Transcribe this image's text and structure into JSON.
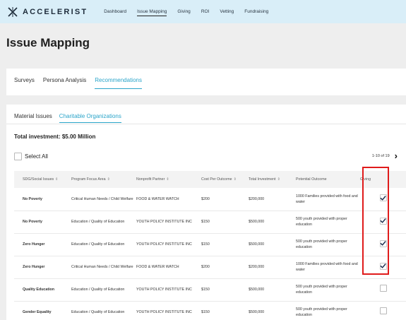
{
  "app": {
    "name": "ACCELERIST",
    "nav": [
      {
        "label": "Dashboard",
        "active": false
      },
      {
        "label": "Issue Mapping",
        "active": true
      },
      {
        "label": "Giving",
        "active": false
      },
      {
        "label": "ROI",
        "active": false
      },
      {
        "label": "Vetting",
        "active": false
      },
      {
        "label": "Fundraising",
        "active": false
      }
    ],
    "brand_color": "#2aa4c9",
    "highlight_color": "#e01b1b"
  },
  "page": {
    "title": "Issue Mapping"
  },
  "tabs": [
    {
      "label": "Surveys",
      "active": false
    },
    {
      "label": "Persona Analysis",
      "active": false
    },
    {
      "label": "Recommendations",
      "active": true
    }
  ],
  "subtabs": [
    {
      "label": "Material Issues",
      "active": false
    },
    {
      "label": "Charitable Organizations",
      "active": true
    }
  ],
  "total_investment": "Total investment: $5.00 Million",
  "select_all_label": "Select All",
  "pagination": {
    "text": "1-10 of 19",
    "next_icon": "chevron-right-icon"
  },
  "table": {
    "columns": [
      {
        "label": "SDG/Social Issues",
        "sortable": true
      },
      {
        "label": "Program Focus Area",
        "sortable": true
      },
      {
        "label": "Nonprofit Partner",
        "sortable": true
      },
      {
        "label": "Cost Per Outcome",
        "sortable": true
      },
      {
        "label": "Total Investment",
        "sortable": true
      },
      {
        "label": "Potential Outcome",
        "sortable": false
      },
      {
        "label": "Giving",
        "sortable": false
      }
    ],
    "rows": [
      {
        "sdg": "No Poverty",
        "focus": "Critical Human Needs / Child Welfare",
        "partner": "FOOD & WATER WATCH",
        "cost": "$200",
        "total": "$200,000",
        "outcome": "1000 Families provided with food and water",
        "giving": true
      },
      {
        "sdg": "No Poverty",
        "focus": "Education / Quality of Education",
        "partner": "YOUTH POLICY INSTITUTE INC",
        "cost": "$150",
        "total": "$500,000",
        "outcome": "500 youth provided with proper education",
        "giving": true
      },
      {
        "sdg": "Zero Hunger",
        "focus": "Education / Quality of Education",
        "partner": "YOUTH POLICY INSTITUTE INC",
        "cost": "$150",
        "total": "$500,000",
        "outcome": "500 youth provided with proper education",
        "giving": true
      },
      {
        "sdg": "Zero Hunger",
        "focus": "Critical Human Needs / Child Welfare",
        "partner": "FOOD & WATER WATCH",
        "cost": "$200",
        "total": "$200,000",
        "outcome": "1000 Families provided with food and water",
        "giving": true
      },
      {
        "sdg": "Quality Education",
        "focus": "Education / Quality of Education",
        "partner": "YOUTH POLICY INSTITUTE INC",
        "cost": "$150",
        "total": "$500,000",
        "outcome": "500 youth provided with proper education",
        "giving": false
      },
      {
        "sdg": "Gender Equality",
        "focus": "Education / Quality of Education",
        "partner": "YOUTH POLICY INSTITUTE INC",
        "cost": "$150",
        "total": "$500,000",
        "outcome": "500 youth provided with proper education",
        "giving": false
      }
    ]
  }
}
